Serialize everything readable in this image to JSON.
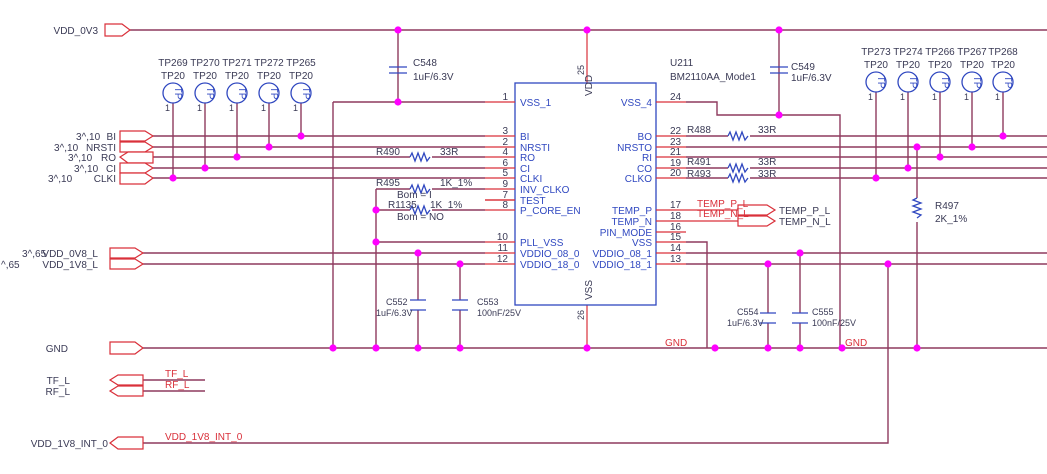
{
  "nets": {
    "vdd_0v3": "VDD_0V3",
    "gnd": "GND",
    "gnd_tag": "GND",
    "vdd_0v8_l": "VDD_0V8_L",
    "vdd_1v8_l": "VDD_1V8_L",
    "tf_l": "TF_L",
    "rf_l": "RF_L",
    "vdd_1v8_int_0": "VDD_1V8_INT_0",
    "bi": "BI",
    "nrsti": "NRSTI",
    "ro": "RO",
    "ci": "CI",
    "clki": "CLKI",
    "temp_p_l": "TEMP_P_L",
    "temp_n_l": "TEMP_N_L"
  },
  "page_refs": {
    "sig": "3^,10",
    "vdd_0v8": "3^,65",
    "vdd_1v8": "^,65"
  },
  "chip": {
    "ref": "U211",
    "part": "BM2110AA_Mode1",
    "vdd": "VDD",
    "vss": "VSS",
    "vdd_pin": "25",
    "vss_pin": "26",
    "left_pins": [
      {
        "num": "1",
        "name": "VSS_1"
      },
      {
        "num": "3",
        "name": "BI"
      },
      {
        "num": "2",
        "name": "NRSTI"
      },
      {
        "num": "4",
        "name": "RO"
      },
      {
        "num": "6",
        "name": "CI"
      },
      {
        "num": "5",
        "name": "CLKI"
      },
      {
        "num": "9",
        "name": "INV_CLKO"
      },
      {
        "num": "7",
        "name": "TEST"
      },
      {
        "num": "8",
        "name": "P_CORE_EN"
      },
      {
        "num": "10",
        "name": "PLL_VSS"
      },
      {
        "num": "11",
        "name": "VDDIO_08_0"
      },
      {
        "num": "12",
        "name": "VDDIO_18_0"
      }
    ],
    "right_pins": [
      {
        "num": "24",
        "name": "VSS_4"
      },
      {
        "num": "22",
        "name": "BO"
      },
      {
        "num": "23",
        "name": "NRSTO"
      },
      {
        "num": "21",
        "name": "RI"
      },
      {
        "num": "19",
        "name": "CO"
      },
      {
        "num": "20",
        "name": "CLKO"
      },
      {
        "num": "17",
        "name": "TEMP_P"
      },
      {
        "num": "18",
        "name": "TEMP_N"
      },
      {
        "num": "16",
        "name": "PIN_MODE"
      },
      {
        "num": "15",
        "name": "VSS"
      },
      {
        "num": "14",
        "name": "VDDIO_08_1"
      },
      {
        "num": "13",
        "name": "VDDIO_18_1"
      }
    ]
  },
  "test_point": {
    "glyph": "TP",
    "pin": "1"
  },
  "test_points_left": [
    {
      "ref": "TP269",
      "value": "TP20"
    },
    {
      "ref": "TP270",
      "value": "TP20"
    },
    {
      "ref": "TP271",
      "value": "TP20"
    },
    {
      "ref": "TP272",
      "value": "TP20"
    },
    {
      "ref": "TP265",
      "value": "TP20"
    }
  ],
  "test_points_right": [
    {
      "ref": "TP273",
      "value": "TP20"
    },
    {
      "ref": "TP274",
      "value": "TP20"
    },
    {
      "ref": "TP266",
      "value": "TP20"
    },
    {
      "ref": "TP267",
      "value": "TP20"
    },
    {
      "ref": "TP268",
      "value": "TP20"
    }
  ],
  "capacitors": {
    "c548": {
      "ref": "C548",
      "value": "1uF/6.3V"
    },
    "c549": {
      "ref": "C549",
      "value": "1uF/6.3V"
    },
    "c552": {
      "ref": "C552",
      "value": "1uF/6.3V"
    },
    "c553": {
      "ref": "C553",
      "value": "100nF/25V"
    },
    "c554": {
      "ref": "C554",
      "value": "1uF/6.3V"
    },
    "c555": {
      "ref": "C555",
      "value": "100nF/25V"
    }
  },
  "resistors": {
    "r490": {
      "ref": "R490",
      "value": "33R"
    },
    "r495": {
      "ref": "R495",
      "value": "1K_1%",
      "bom": "Bom = I"
    },
    "r1135": {
      "ref": "R1135",
      "value": "1K_1%",
      "bom": "Bom = NO"
    },
    "r488": {
      "ref": "R488",
      "value": "33R"
    },
    "r491": {
      "ref": "R491",
      "value": "33R"
    },
    "r493": {
      "ref": "R493",
      "value": "33R"
    },
    "r497": {
      "ref": "R497",
      "value": "2K_1%"
    }
  },
  "colors": {
    "wire": "#8e3a5e",
    "pin": "#d9303a",
    "component": "#3048c0",
    "junction": "#ff00ff"
  }
}
